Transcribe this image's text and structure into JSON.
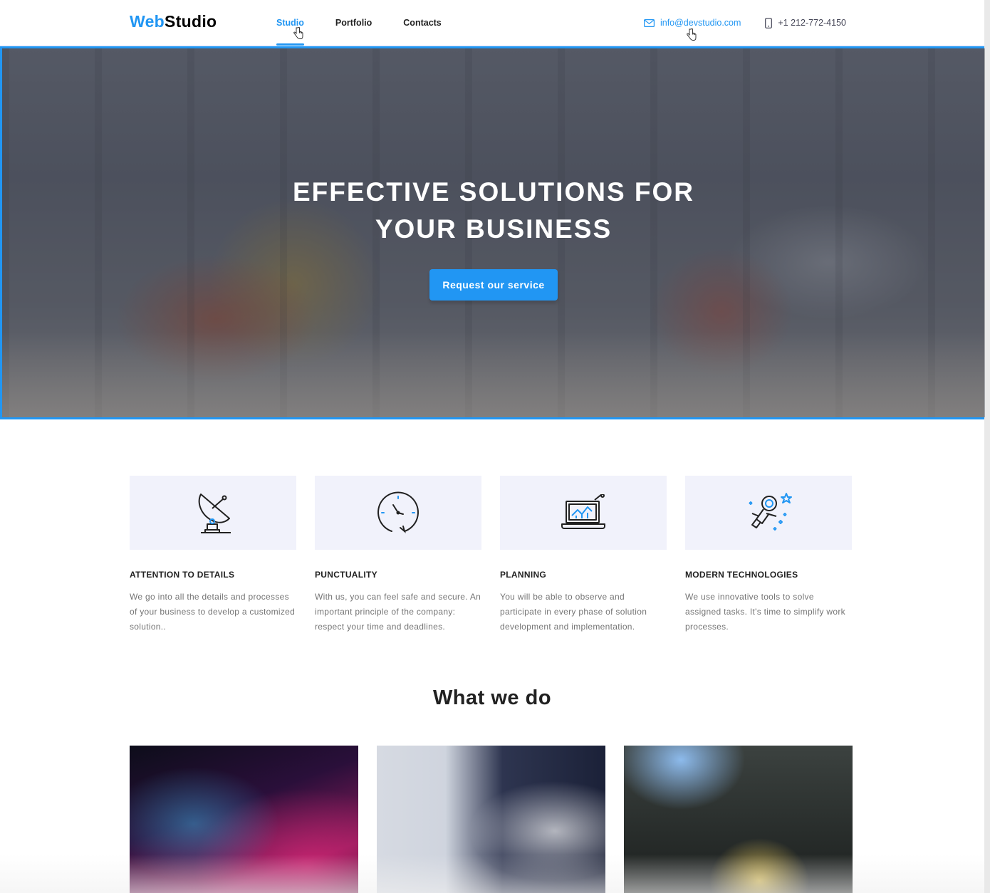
{
  "header": {
    "logo_part1": "Web",
    "logo_part2": "Studio",
    "nav": [
      {
        "label": "Studio",
        "active": true
      },
      {
        "label": "Portfolio",
        "active": false
      },
      {
        "label": "Contacts",
        "active": false
      }
    ],
    "email": "info@devstudio.com",
    "phone": "+1 212-772-4150"
  },
  "hero": {
    "title": "EFFECTIVE SOLUTIONS FOR YOUR BUSINESS",
    "button_label": "Request our service"
  },
  "features": [
    {
      "icon": "satellite-dish-icon",
      "title": "ATTENTION TO DETAILS",
      "text": "We go into all the details and processes of your business to develop a customized solution.."
    },
    {
      "icon": "clock-icon",
      "title": "PUNCTUALITY",
      "text": "With us, you can feel safe and secure. An important principle of the company: respect your time and deadlines."
    },
    {
      "icon": "laptop-chart-icon",
      "title": "PLANNING",
      "text": "You will be able to observe and participate in every phase of solution development and implementation."
    },
    {
      "icon": "astronaut-icon",
      "title": "MODERN TECHNOLOGIES",
      "text": "We use innovative tools to solve assigned tasks. It's time to simplify work processes."
    }
  ],
  "section": {
    "title": "What we do"
  },
  "colors": {
    "accent": "#2196f3",
    "text": "#212121",
    "muted": "#757575",
    "feature_bg": "#f1f2fb"
  }
}
